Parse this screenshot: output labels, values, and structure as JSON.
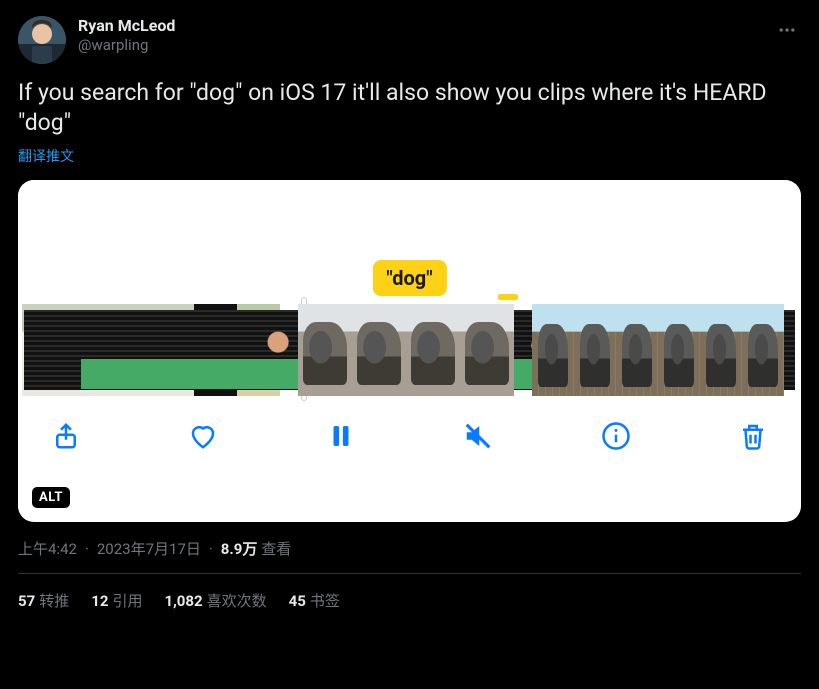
{
  "author": {
    "display_name": "Ryan McLeod",
    "handle": "@warpling"
  },
  "tweet_text": "If you search for \"dog\" on iOS 17 it'll also show you clips where it's HEARD \"dog\"",
  "translate_label": "翻译推文",
  "media": {
    "caption_bubble": "\"dog\"",
    "alt_badge": "ALT"
  },
  "meta": {
    "time": "上午4:42",
    "date": "2023年7月17日",
    "views_count": "8.9万",
    "views_label": "查看"
  },
  "stats": {
    "retweets_count": "57",
    "retweets_label": "转推",
    "quotes_count": "12",
    "quotes_label": "引用",
    "likes_count": "1,082",
    "likes_label": "喜欢次数",
    "bookmarks_count": "45",
    "bookmarks_label": "书签"
  }
}
